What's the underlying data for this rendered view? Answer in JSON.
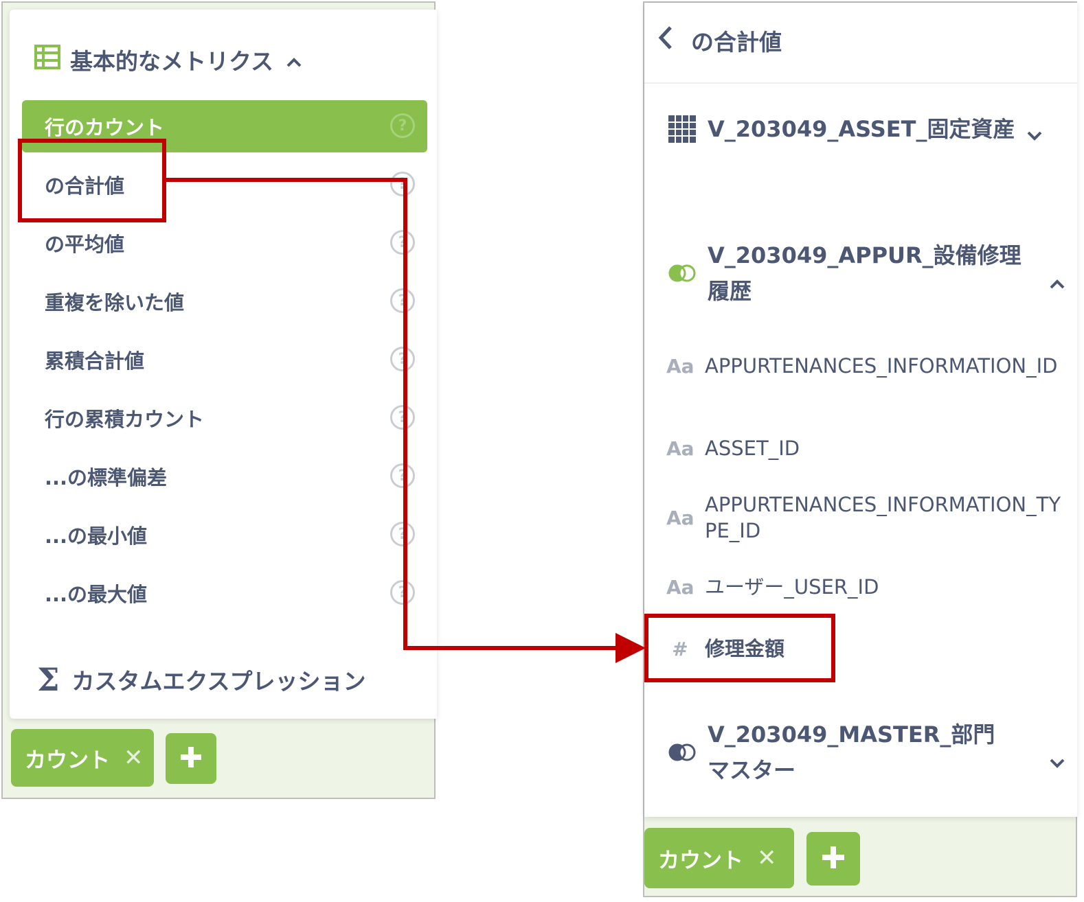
{
  "left_panel": {
    "section_title": "基本的なメトリクス",
    "metrics": [
      {
        "label": "行のカウント",
        "help": "?"
      },
      {
        "label": "の合計値",
        "help": "?"
      },
      {
        "label": "の平均値",
        "help": "?"
      },
      {
        "label": "重複を除いた値",
        "help": "?"
      },
      {
        "label": "累積合計値",
        "help": "?"
      },
      {
        "label": "行の累積カウント",
        "help": "?"
      },
      {
        "label": "...の標準偏差",
        "help": "?"
      },
      {
        "label": "...の最小値",
        "help": "?"
      },
      {
        "label": "...の最大値",
        "help": "?"
      }
    ],
    "custom_expression": {
      "icon": "Σ",
      "label": "カスタムエクスプレッション"
    },
    "pill": {
      "label": "カウント",
      "remove": "✕"
    }
  },
  "right_panel": {
    "header_title": "の合計値",
    "tables": [
      {
        "label": "V_203049_ASSET_固定資産",
        "icon": "table-grid-icon"
      },
      {
        "label": "V_203049_APPUR_設備修理履歴",
        "icon": "joined-table-icon"
      },
      {
        "label": "V_203049_MASTER_部門マスター",
        "icon": "joined-table-icon"
      }
    ],
    "fields": [
      {
        "type": "Aa",
        "label": "APPURTENANCES_INFORMATION_ID"
      },
      {
        "type": "Aa",
        "label": "ASSET_ID"
      },
      {
        "type": "Aa",
        "label": "APPURTENANCES_INFORMATION_TYPE_ID"
      },
      {
        "type": "Aa",
        "label": "ユーザー_USER_ID"
      },
      {
        "type": "#",
        "label": "修理金額"
      }
    ],
    "pill": {
      "label": "カウント",
      "remove": "✕"
    }
  },
  "colors": {
    "brand_green": "#88bf4d",
    "text": "#4c5773",
    "annotation_red": "#c00000",
    "muted_icon": "#a9afba"
  }
}
